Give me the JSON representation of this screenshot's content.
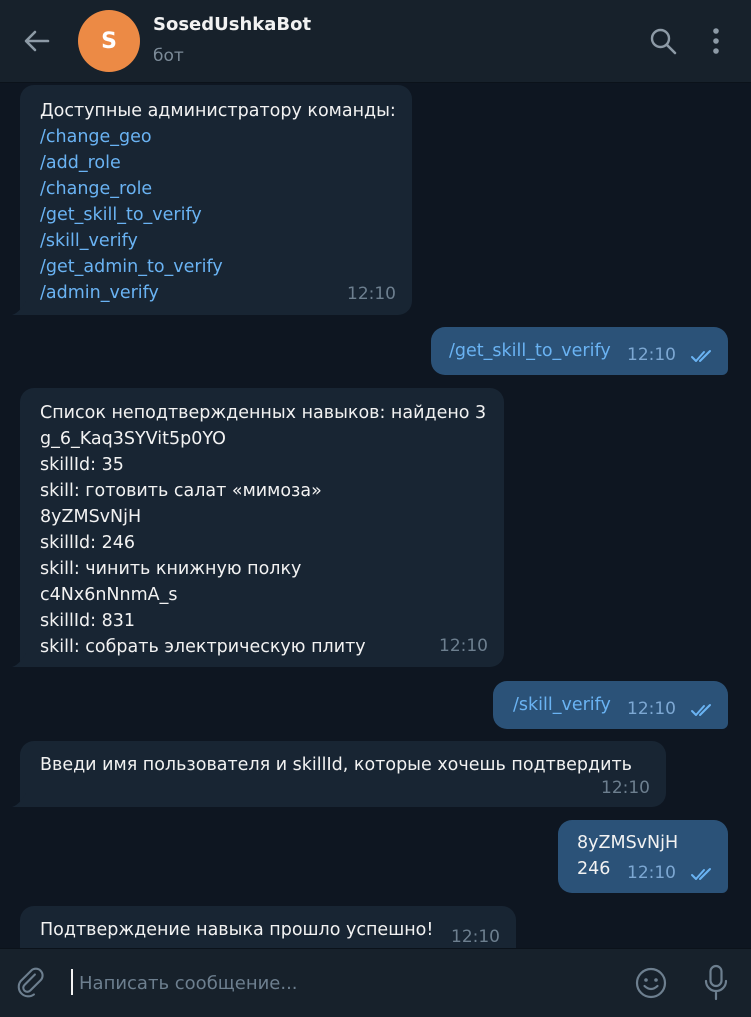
{
  "header": {
    "title": "SosedUshkaBot",
    "status": "бот",
    "avatar_letter": "S",
    "avatar_color": "#ec8a45",
    "back_icon": "arrow-left-icon",
    "search_icon": "search-icon",
    "menu_icon": "more-vertical-icon"
  },
  "messages": [
    {
      "direction": "in",
      "lines": [
        {
          "text": "Доступные администратору команды:",
          "cmd": false
        },
        {
          "text": "/change_geo",
          "cmd": true
        },
        {
          "text": "/add_role",
          "cmd": true
        },
        {
          "text": "/change_role",
          "cmd": true
        },
        {
          "text": "/get_skill_to_verify",
          "cmd": true
        },
        {
          "text": "/skill_verify",
          "cmd": true
        },
        {
          "text": "/get_admin_to_verify",
          "cmd": true
        },
        {
          "text": "/admin_verify",
          "cmd": true
        }
      ],
      "time": "12:10"
    },
    {
      "direction": "out",
      "text": "/get_skill_to_verify",
      "time": "12:10",
      "status": "read"
    },
    {
      "direction": "in",
      "lines": [
        {
          "text": "Список неподтвержденных навыков: найдено 3",
          "cmd": false
        },
        {
          "text": "g_6_Kaq3SYVit5p0YO",
          "cmd": false
        },
        {
          "text": "skillId: 35",
          "cmd": false
        },
        {
          "text": "skill: готовить салат «мимоза»",
          "cmd": false
        },
        {
          "text": "8yZMSvNjH",
          "cmd": false
        },
        {
          "text": "skillId: 246",
          "cmd": false
        },
        {
          "text": "skill: чинить книжную полку",
          "cmd": false
        },
        {
          "text": "c4Nx6nNnmA_s",
          "cmd": false
        },
        {
          "text": "skillId: 831",
          "cmd": false
        },
        {
          "text": "skill: собрать электрическую плиту",
          "cmd": false
        }
      ],
      "time": "12:10"
    },
    {
      "direction": "out",
      "text": "/skill_verify",
      "time": "12:10",
      "status": "read"
    },
    {
      "direction": "in",
      "lines": [
        {
          "text": "Введи имя пользователя и skillId, которые хочешь подтвердить",
          "cmd": false
        }
      ],
      "time": "12:10"
    },
    {
      "direction": "out",
      "lines": [
        "8yZMSvNjH",
        "246"
      ],
      "time": "12:10",
      "status": "read"
    },
    {
      "direction": "in",
      "lines": [
        {
          "text": "Подтверждение навыка прошло успешно!",
          "cmd": false
        }
      ],
      "time": "12:10"
    }
  ],
  "composer": {
    "placeholder": "Написать сообщение...",
    "value": "",
    "attach_icon": "paperclip-icon",
    "emoji_icon": "smile-icon",
    "mic_icon": "microphone-icon"
  },
  "colors": {
    "background": "#0e1621",
    "header": "#17212b",
    "incoming_bubble": "#182533",
    "outgoing_bubble": "#2b5278",
    "link": "#6ab3f3",
    "read_ticks": "#6ab3f3"
  }
}
